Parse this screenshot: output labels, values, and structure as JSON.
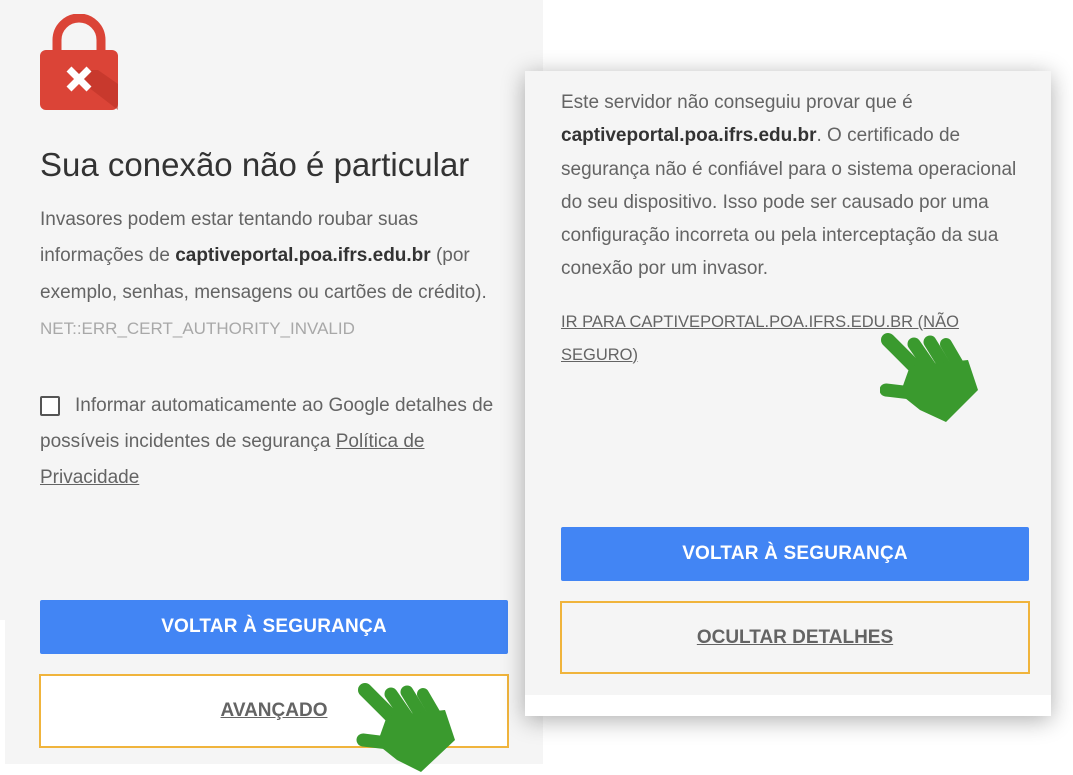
{
  "page": {
    "lock_icon": "lock-error-icon",
    "title": "Sua conexão não é particular",
    "intro": {
      "prefix": "Invasores podem estar tentando roubar suas informações de ",
      "host": "captiveportal.poa.ifrs.edu.br",
      "suffix": " (por exemplo, senhas, mensagens ou cartões de crédito). ",
      "error_code": "NET::ERR_CERT_AUTHORITY_INVALID"
    },
    "report": {
      "checked": false,
      "text": "Informar automaticamente ao Google detalhes de possíveis incidentes de segurança ",
      "privacy_link": "Política de Privacidade"
    },
    "back_button": "VOLTAR À SEGURANÇA",
    "advanced_button": "AVANÇADO"
  },
  "details_panel": {
    "text_prefix": "Este servidor não conseguiu provar que é ",
    "host": "captiveportal.poa.ifrs.edu.br",
    "text_suffix": ". O certificado de segurança não é confiável para o sistema operacional do seu dispositivo. Isso pode ser causado por uma configuração incorreta ou pela interceptação da sua conexão por um invasor.",
    "proceed_link": "IR PARA CAPTIVEPORTAL.POA.IFRS.EDU.BR (NÃO SEGURO)",
    "back_button": "VOLTAR À SEGURANÇA",
    "hide_details_button": "OCULTAR DETALHES"
  },
  "annotations": {
    "pointer_icon": "pointing-hand-icon"
  },
  "colors": {
    "accent_blue": "#4285f4",
    "outline_orange": "#f0b43c",
    "lock_red": "#db4437",
    "hand_green": "#3a9a2e"
  }
}
